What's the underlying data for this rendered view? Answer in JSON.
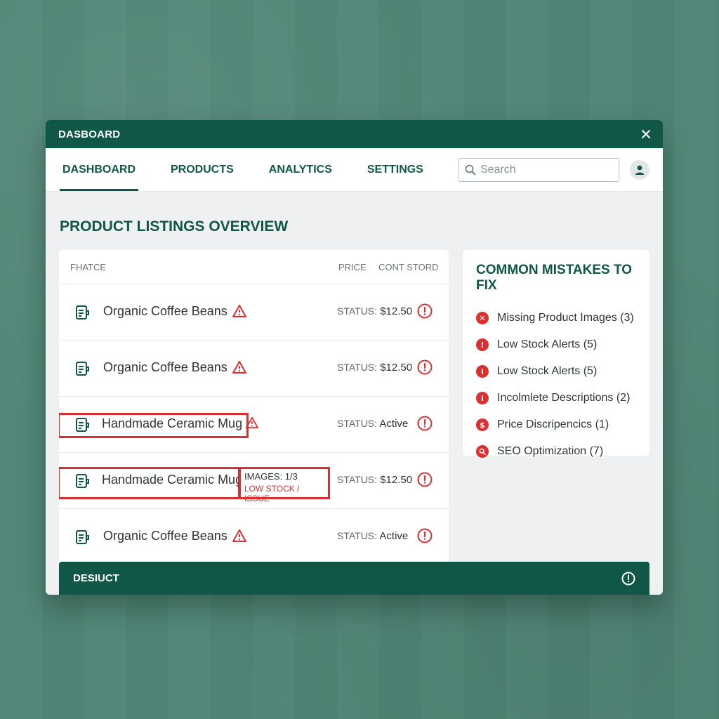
{
  "window": {
    "title": "DASBOARD"
  },
  "nav": {
    "tabs": [
      {
        "label": "DASHBOARD",
        "active": true
      },
      {
        "label": "PRODUCTS",
        "active": false
      },
      {
        "label": "ANALYTICS",
        "active": false
      },
      {
        "label": "SETTINGS",
        "active": false
      }
    ],
    "search_placeholder": "Search"
  },
  "page": {
    "title": "PRODUCT LISTINGS OVERVIEW"
  },
  "listing": {
    "headers": {
      "name": "FHATCE",
      "price": "PRICE",
      "stock": "CONT STORD"
    },
    "rows": [
      {
        "name": "Organic Coffee Beans",
        "status_label": "STATUS:",
        "status_value": "$12.50",
        "highlighted": false
      },
      {
        "name": "Organic Coffee Beans",
        "status_label": "STATUS:",
        "status_value": "$12.50",
        "highlighted": false
      },
      {
        "name": "Handmade Ceramic Mug",
        "status_label": "STATUS:",
        "status_value": "Active",
        "highlighted": true
      },
      {
        "name": "Handmade Ceramic Mug",
        "status_label": "STATUS:",
        "status_value": "$12.50",
        "highlighted": true,
        "issue_images": "IMAGES: 1/3",
        "issue_text": "LOW STOCK / ISSUE"
      },
      {
        "name": "Organic Coffee Beans",
        "status_label": "STATUS:",
        "status_value": "Active",
        "highlighted": false
      }
    ]
  },
  "mistakes": {
    "title": "COMMON MISTAKES TO FIX",
    "items": [
      {
        "label": "Missing Product Images (3)",
        "icon": "x-circle-icon"
      },
      {
        "label": "Low Stock Alerts (5)",
        "icon": "exclamation-circle-icon"
      },
      {
        "label": "Low Stock Alerts (5)",
        "icon": "info-circle-icon"
      },
      {
        "label": "Incolmlete Descriptions (2)",
        "icon": "info-circle-icon"
      },
      {
        "label": "Price Discripencics (1)",
        "icon": "dollar-circle-icon"
      },
      {
        "label": "SEO Optimization (7)",
        "icon": "magnifier-circle-icon"
      }
    ]
  },
  "bottom_bar": {
    "label": "DESIUCT"
  },
  "colors": {
    "brand": "#115747",
    "alert": "#dc2f2f",
    "background": "#4f8677"
  }
}
